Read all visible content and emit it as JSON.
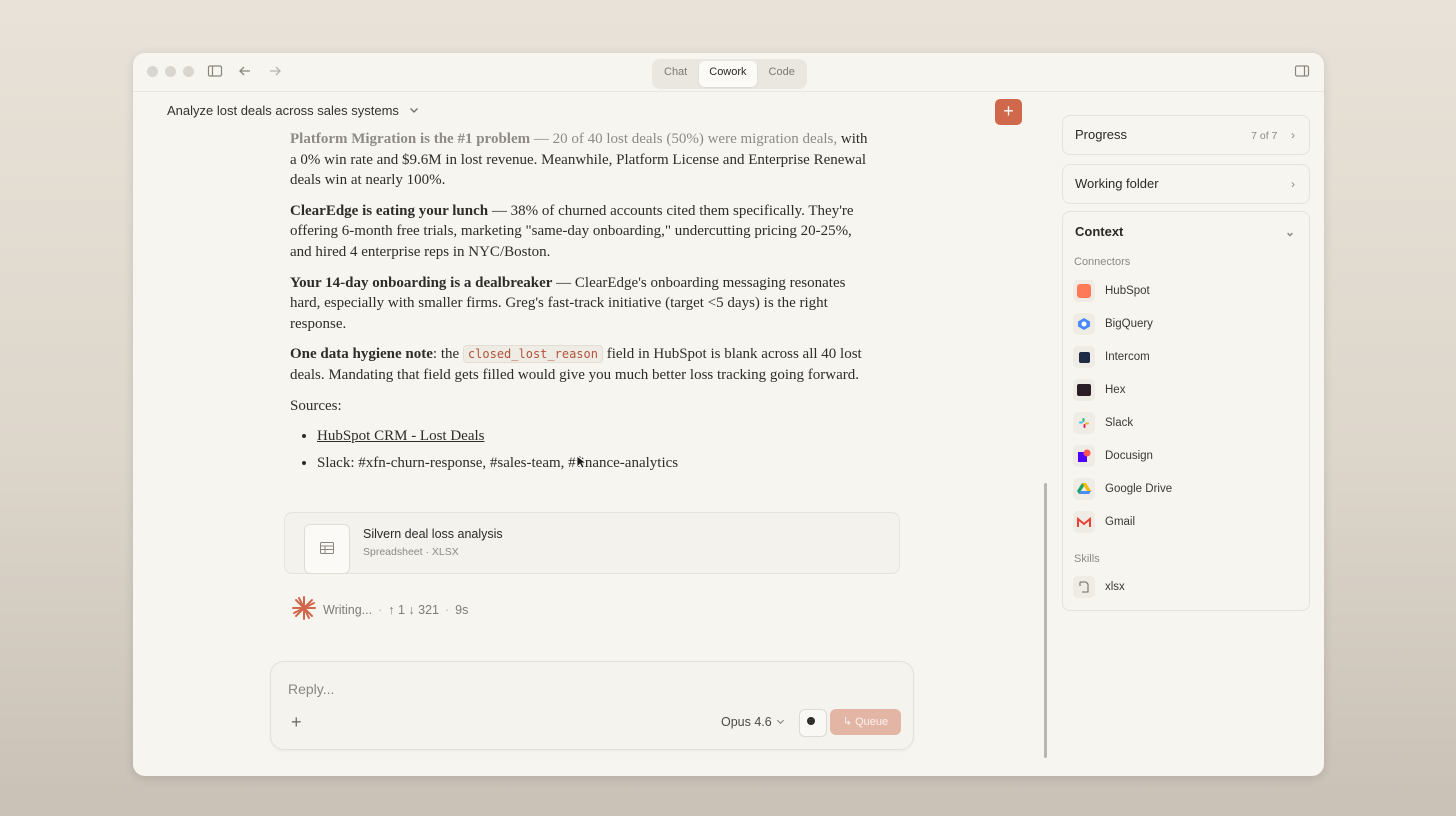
{
  "tabs": [
    "Chat",
    "Cowork",
    "Code"
  ],
  "active_tab": "Cowork",
  "conversation": {
    "title": "Analyze lost deals across sales systems"
  },
  "message": {
    "p1_bold": "Platform Migration is the #1 problem",
    "p1_text": " — 20 of 40 lost deals (50%) were migration deals,",
    "p1_rest": "with a 0% win rate and $9.6M in lost revenue. Meanwhile, Platform License and Enterprise Renewal deals win at nearly 100%.",
    "p2_bold": "ClearEdge is eating your lunch",
    "p2_text": " — 38% of churned accounts cited them specifically. They're offering 6-month free trials, marketing \"same-day onboarding,\" undercutting pricing 20-25%, and hired 4 enterprise reps in NYC/Boston.",
    "p3_bold": "Your 14-day onboarding is a dealbreaker",
    "p3_text": " — ClearEdge's onboarding messaging resonates hard, especially with smaller firms. Greg's fast-track initiative (target <5 days) is the right response.",
    "p4_bold": "One data hygiene note",
    "p4_pre": ": the ",
    "p4_code": "closed_lost_reason",
    "p4_text": " field in HubSpot is blank across all 40 lost deals. Mandating that field gets filled would give you much better loss tracking going forward.",
    "sources_label": "Sources:",
    "sources": [
      "HubSpot CRM - Lost Deals",
      "Slack: #xfn-churn-response, #sales-team, #finance-analytics"
    ]
  },
  "file_card": {
    "name": "Silvern deal loss analysis",
    "meta": "Spreadsheet · XLSX"
  },
  "status": {
    "state": "Writing...",
    "tokens": "↑ 1 ↓ 321",
    "elapsed": "9s"
  },
  "composer": {
    "placeholder": "Reply...",
    "model": "Opus 4.6",
    "queue_label": "Queue"
  },
  "sidebar": {
    "progress_label": "Progress",
    "progress_count": "7 of 7",
    "working_folder_label": "Working folder",
    "context_label": "Context",
    "connectors_label": "Connectors",
    "connectors": [
      {
        "name": "HubSpot",
        "icon": "hubspot-icon",
        "color": "#ff7a59"
      },
      {
        "name": "BigQuery",
        "icon": "bigquery-icon",
        "color": "#4c8bf5"
      },
      {
        "name": "Intercom",
        "icon": "intercom-icon",
        "color": "#1f2a44"
      },
      {
        "name": "Hex",
        "icon": "hex-icon",
        "color": "#2a1d25"
      },
      {
        "name": "Slack",
        "icon": "slack-icon",
        "color": "#e01e5a"
      },
      {
        "name": "Docusign",
        "icon": "docusign-icon",
        "color": "#4c00ff"
      },
      {
        "name": "Google Drive",
        "icon": "google-drive-icon",
        "color": "#1fa463"
      },
      {
        "name": "Gmail",
        "icon": "gmail-icon",
        "color": "#ea4335"
      }
    ],
    "skills_label": "Skills",
    "skills": [
      {
        "name": "xlsx",
        "icon": "skill-icon"
      }
    ]
  },
  "colors": {
    "accent": "#d0694c",
    "background": "#f7f5f0"
  }
}
